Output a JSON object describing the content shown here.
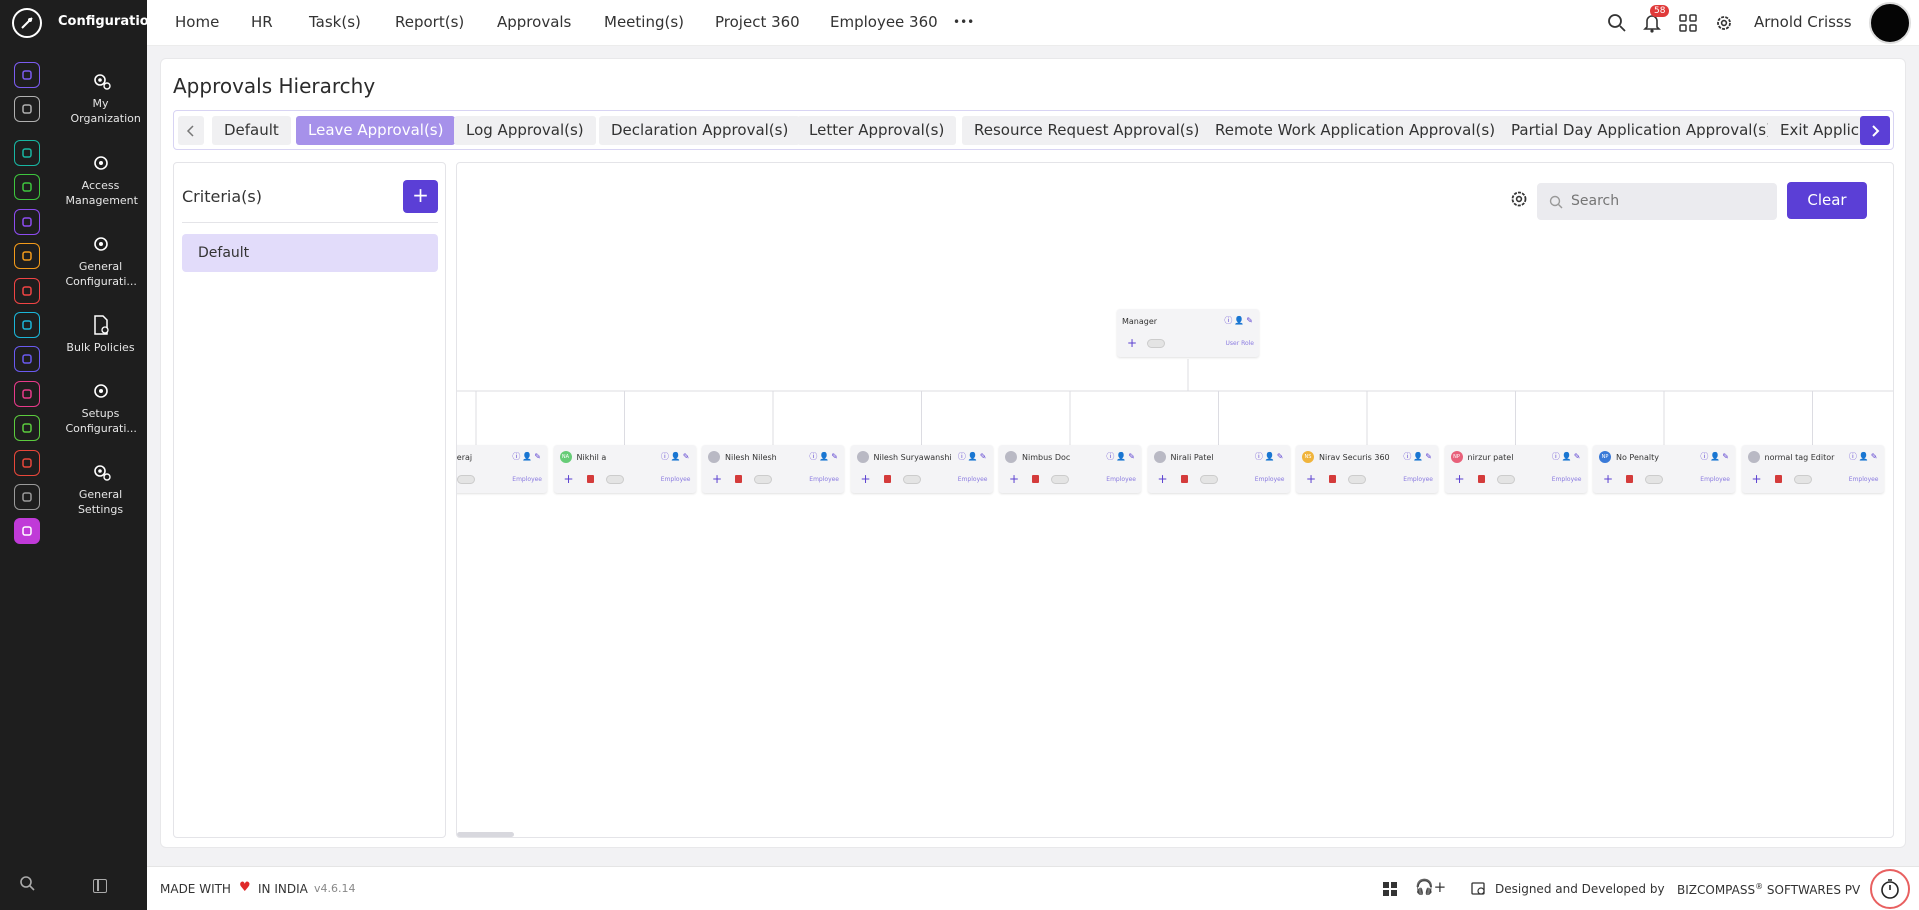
{
  "app": {
    "section_title": "Configuration"
  },
  "subnav": {
    "items": [
      {
        "label": "My Organization"
      },
      {
        "label": "Access Management"
      },
      {
        "label": "General Configurati..."
      },
      {
        "label": "Bulk Policies"
      },
      {
        "label": "Setups Configurati..."
      },
      {
        "label": "General Settings"
      }
    ]
  },
  "rail_icons": [
    {
      "name": "home-icon",
      "color": "#7b5cf0"
    },
    {
      "name": "pin-icon",
      "color": "#b0b0b0"
    },
    {
      "name": "people-icon",
      "color": "#18b6a2"
    },
    {
      "name": "money-icon",
      "color": "#3ec63e"
    },
    {
      "name": "briefcase-icon",
      "color": "#8d4cf0"
    },
    {
      "name": "wheat-icon",
      "color": "#f29a1a"
    },
    {
      "name": "target-icon",
      "color": "#f04444"
    },
    {
      "name": "calendar-icon",
      "color": "#1bb5d8"
    },
    {
      "name": "plane-icon",
      "color": "#6a5af0"
    },
    {
      "name": "presentation-icon",
      "color": "#e83a8a"
    },
    {
      "name": "doc-icon",
      "color": "#5ccc3e"
    },
    {
      "name": "award-icon",
      "color": "#e8473a"
    },
    {
      "name": "house-icon",
      "color": "#9a9a9a"
    },
    {
      "name": "settings-icon",
      "color": "#c03ad8"
    }
  ],
  "topnav": {
    "items": [
      "Home",
      "HR",
      "Task(s)",
      "Report(s)",
      "Approvals",
      "Meeting(s)",
      "Project 360",
      "Employee 360"
    ],
    "more": "•••",
    "notification_count": "58",
    "user_name": "Arnold Crisss"
  },
  "page": {
    "title": "Approvals Hierarchy"
  },
  "tabs": [
    "Default",
    "Leave Approval(s)",
    "Log Approval(s)",
    "Declaration Approval(s)",
    "Letter Approval(s)",
    "Resource Request Approval(s)",
    "Remote Work Application Approval(s)",
    "Partial Day Application Approval(s)",
    "Exit Applic"
  ],
  "active_tab": 1,
  "criteria": {
    "title": "Criteria(s)",
    "items": [
      "Default"
    ]
  },
  "chart_toolbar": {
    "search_placeholder": "Search",
    "clear_label": "Clear"
  },
  "root_node": {
    "name": "Manager",
    "role": "User Role"
  },
  "child_nodes": [
    {
      "name": "eraj Neeraj",
      "initials": "",
      "avatar_color": "",
      "role": "Employee"
    },
    {
      "name": "Nikhil a",
      "initials": "NA",
      "avatar_color": "#66cc77",
      "role": "Employee"
    },
    {
      "name": "Nilesh Nilesh",
      "initials": "",
      "avatar_color": "#b9b9c4",
      "role": "Employee"
    },
    {
      "name": "Nilesh Suryawanshi",
      "initials": "",
      "avatar_color": "#b9b9c4",
      "role": "Employee"
    },
    {
      "name": "Nimbus Doc",
      "initials": "",
      "avatar_color": "#b9b9c4",
      "role": "Employee"
    },
    {
      "name": "Nirali Patel",
      "initials": "",
      "avatar_color": "#b9b9c4",
      "role": "Employee"
    },
    {
      "name": "Nirav Securis 360",
      "initials": "NS",
      "avatar_color": "#f0b43c",
      "role": "Employee"
    },
    {
      "name": "nirzur patel",
      "initials": "NP",
      "avatar_color": "#e8607a",
      "role": "Employee"
    },
    {
      "name": "No Penalty",
      "initials": "NP",
      "avatar_color": "#3a7ad8",
      "role": "Employee"
    },
    {
      "name": "normal tag Editor",
      "initials": "",
      "avatar_color": "#b9b9c4",
      "role": "Employee"
    }
  ],
  "footer": {
    "made_with": "MADE WITH",
    "in_india": "IN INDIA",
    "version": "v4.6.14",
    "designed_by": "Designed and Developed by",
    "company": "BIZCOMPASS",
    "registered": "®",
    "company_suffix": "SOFTWARES PV"
  }
}
